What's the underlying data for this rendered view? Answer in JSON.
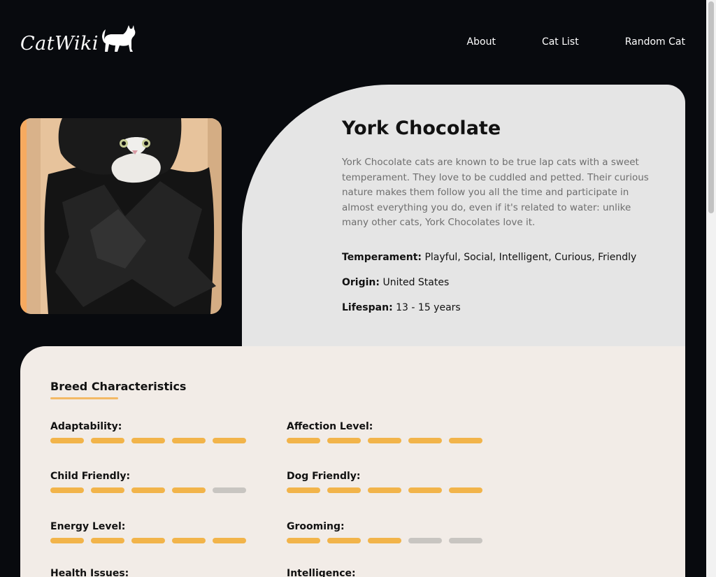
{
  "header": {
    "logo_text": "CatWiki",
    "nav": [
      "About",
      "Cat List",
      "Random Cat"
    ]
  },
  "breed": {
    "name": "York Chocolate",
    "description": "York Chocolate cats are known to be true lap cats with a sweet temperament. They love to be cuddled and petted. Their curious nature makes them follow you all the time and participate in almost everything you do, even if it's related to water: unlike many other cats, York Chocolates love it.",
    "temperament_label": "Temperament:",
    "temperament": "Playful, Social, Intelligent, Curious, Friendly",
    "origin_label": "Origin:",
    "origin": "United States",
    "lifespan_label": "Lifespan:",
    "lifespan": "13 - 15 years"
  },
  "characteristics": {
    "title": "Breed Characteristics",
    "items": [
      {
        "label": "Adaptability:",
        "rating": 5
      },
      {
        "label": "Affection Level:",
        "rating": 5
      },
      {
        "label": "Child Friendly:",
        "rating": 4
      },
      {
        "label": "Dog Friendly:",
        "rating": 5
      },
      {
        "label": "Energy Level:",
        "rating": 5
      },
      {
        "label": "Grooming:",
        "rating": 3
      },
      {
        "label": "Health Issues:",
        "rating": null
      },
      {
        "label": "Intelligence:",
        "rating": null
      }
    ],
    "max_rating": 5
  },
  "colors": {
    "background": "#080a0e",
    "accent": "#f2b44a",
    "inactive_bar": "#c8c5c1",
    "hero_card": "#e5e5e5",
    "char_card": "#f2ece7"
  }
}
